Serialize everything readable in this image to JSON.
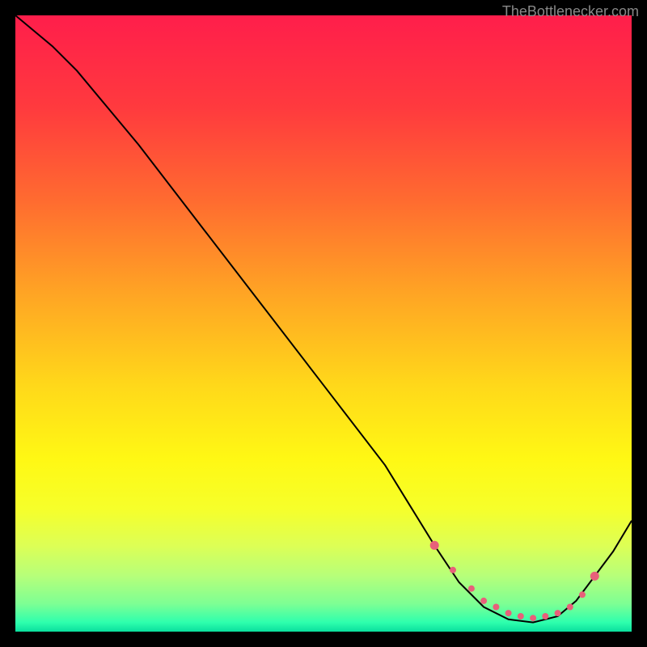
{
  "watermark": "TheBottlenecker.com",
  "chart_data": {
    "type": "line",
    "title": "",
    "xlabel": "",
    "ylabel": "",
    "xlim": [
      0,
      100
    ],
    "ylim": [
      0,
      100
    ],
    "series": [
      {
        "name": "curve",
        "x": [
          0,
          6,
          10,
          20,
          30,
          40,
          50,
          60,
          68,
          72,
          76,
          80,
          84,
          88,
          91,
          94,
          97,
          100
        ],
        "values": [
          100,
          95,
          91,
          79,
          66,
          53,
          40,
          27,
          14,
          8,
          4,
          2,
          1.5,
          2.5,
          5,
          9,
          13,
          18
        ]
      }
    ],
    "markers": {
      "name": "flat-region-dots",
      "x": [
        68,
        71,
        74,
        76,
        78,
        80,
        82,
        84,
        86,
        88,
        90,
        92,
        94
      ],
      "values": [
        14,
        10,
        7,
        5,
        4,
        3,
        2.5,
        2.2,
        2.5,
        3,
        4,
        6,
        9
      ]
    },
    "gradient_stops": [
      {
        "offset": 0.0,
        "color": "#ff1e4b"
      },
      {
        "offset": 0.15,
        "color": "#ff3a3e"
      },
      {
        "offset": 0.3,
        "color": "#ff6b30"
      },
      {
        "offset": 0.45,
        "color": "#ffa424"
      },
      {
        "offset": 0.6,
        "color": "#ffd81a"
      },
      {
        "offset": 0.72,
        "color": "#fff814"
      },
      {
        "offset": 0.8,
        "color": "#f6ff2a"
      },
      {
        "offset": 0.86,
        "color": "#ddff55"
      },
      {
        "offset": 0.91,
        "color": "#b6ff7a"
      },
      {
        "offset": 0.955,
        "color": "#7dff94"
      },
      {
        "offset": 0.985,
        "color": "#2effad"
      },
      {
        "offset": 1.0,
        "color": "#0adf9e"
      }
    ],
    "curve_color": "#000000",
    "marker_color": "#e8607a"
  }
}
